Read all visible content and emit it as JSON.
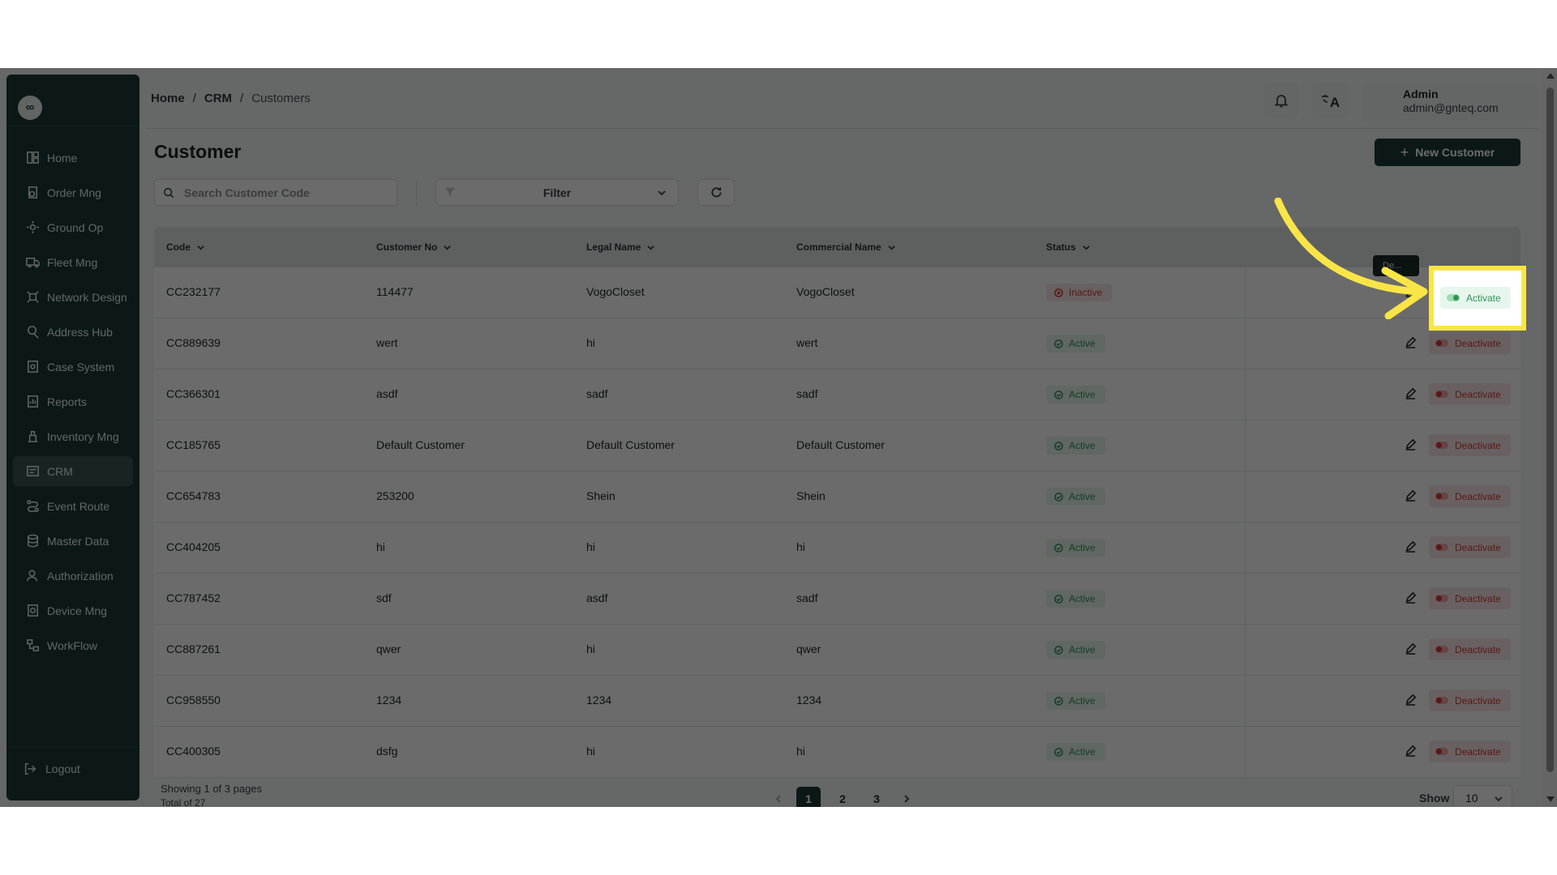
{
  "sidebar": {
    "logo": "∞",
    "items": [
      {
        "label": "Home",
        "icon": "home-icon"
      },
      {
        "label": "Order Mng",
        "icon": "order-icon"
      },
      {
        "label": "Ground Op",
        "icon": "ground-op-icon"
      },
      {
        "label": "Fleet Mng",
        "icon": "truck-icon"
      },
      {
        "label": "Network Design",
        "icon": "network-icon"
      },
      {
        "label": "Address Hub",
        "icon": "address-icon"
      },
      {
        "label": "Case System",
        "icon": "case-icon"
      },
      {
        "label": "Reports",
        "icon": "reports-icon"
      },
      {
        "label": "Inventory Mng",
        "icon": "inventory-icon"
      },
      {
        "label": "CRM",
        "icon": "crm-icon",
        "active": true
      },
      {
        "label": "Event Route",
        "icon": "route-icon"
      },
      {
        "label": "Master Data",
        "icon": "database-icon"
      },
      {
        "label": "Authorization",
        "icon": "user-icon"
      },
      {
        "label": "Device Mng",
        "icon": "device-icon"
      },
      {
        "label": "WorkFlow",
        "icon": "workflow-icon"
      }
    ],
    "logout": "Logout"
  },
  "header": {
    "breadcrumb": [
      "Home",
      "/",
      "CRM",
      "/",
      "Customers"
    ],
    "user_name": "Admin",
    "user_email": "admin@gnteq.com",
    "lang_icon_text": "A"
  },
  "page": {
    "title": "Customer",
    "new_button": "New Customer",
    "search_placeholder": "Search Customer Code",
    "filter_label": "Filter"
  },
  "table": {
    "columns": [
      "Code",
      "Customer No",
      "Legal Name",
      "Commercial Name",
      "Status"
    ],
    "rows": [
      {
        "code": "CC232177",
        "customer_no": "114477",
        "legal_name": "VogoCloset",
        "commercial_name": "VogoCloset",
        "status": "Inactive",
        "action": "Activate"
      },
      {
        "code": "CC889639",
        "customer_no": "wert",
        "legal_name": "hi",
        "commercial_name": "wert",
        "status": "Active",
        "action": "Deactivate"
      },
      {
        "code": "CC366301",
        "customer_no": "asdf",
        "legal_name": "sadf",
        "commercial_name": "sadf",
        "status": "Active",
        "action": "Deactivate"
      },
      {
        "code": "CC185765",
        "customer_no": "Default Customer",
        "legal_name": "Default Customer",
        "commercial_name": "Default Customer",
        "status": "Active",
        "action": "Deactivate"
      },
      {
        "code": "CC654783",
        "customer_no": "253200",
        "legal_name": "Shein",
        "commercial_name": "Shein",
        "status": "Active",
        "action": "Deactivate"
      },
      {
        "code": "CC404205",
        "customer_no": "hi",
        "legal_name": "hi",
        "commercial_name": "hi",
        "status": "Active",
        "action": "Deactivate"
      },
      {
        "code": "CC787452",
        "customer_no": "sdf",
        "legal_name": "asdf",
        "commercial_name": "sadf",
        "status": "Active",
        "action": "Deactivate"
      },
      {
        "code": "CC887261",
        "customer_no": "qwer",
        "legal_name": "hi",
        "commercial_name": "qwer",
        "status": "Active",
        "action": "Deactivate"
      },
      {
        "code": "CC958550",
        "customer_no": "1234",
        "legal_name": "1234",
        "commercial_name": "1234",
        "status": "Active",
        "action": "Deactivate"
      },
      {
        "code": "CC400305",
        "customer_no": "dsfg",
        "legal_name": "hi",
        "commercial_name": "hi",
        "status": "Active",
        "action": "Deactivate"
      }
    ],
    "tooltip": "De..."
  },
  "footer": {
    "showing": "Showing 1 of 3 pages",
    "total": "Total of 27",
    "pages": [
      "1",
      "2",
      "3"
    ],
    "current_page": "1",
    "show_label": "Show",
    "page_size": "10"
  },
  "highlight": {
    "action_label": "Activate",
    "color": "#f9e547"
  },
  "colors": {
    "primary": "#1d3a3a",
    "active": "#2f9456",
    "inactive": "#d23b3b"
  }
}
